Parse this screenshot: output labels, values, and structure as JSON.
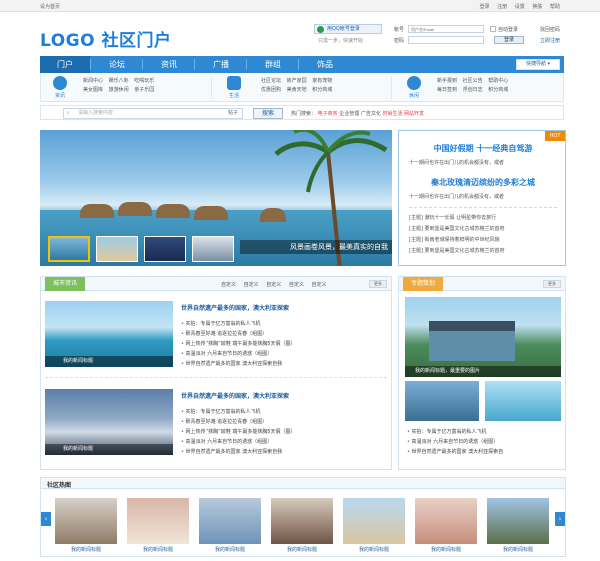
{
  "topbar": {
    "set_home": "设为首页",
    "links": [
      "登录",
      "注册",
      "设置",
      "换肤",
      "帮助"
    ]
  },
  "header": {
    "logo": "LOGO 社区门户",
    "qq_button": "用QQ帐号登录",
    "qq_sub": "只需一步，快速开始",
    "login": {
      "account_label": "帐号",
      "account_placeholder": "用户名/Email",
      "auto_login": "自动登录",
      "forgot": "找回密码",
      "password_label": "密码",
      "submit": "登录",
      "register": "立即注册"
    }
  },
  "nav": {
    "items": [
      "门户",
      "论坛",
      "资讯",
      "广播",
      "群组",
      "饰品"
    ],
    "active": 0,
    "quick": "快捷导航"
  },
  "subnav": {
    "groups": [
      {
        "label": "资讯",
        "links": [
          "新闻中心",
          "娱乐八卦",
          "吃喝玩乐",
          "美女图库",
          "旅游休闲",
          "亲子乐园"
        ],
        "color": "#2f88d4"
      },
      {
        "label": "生活",
        "links": [
          "社区论坛",
          "房产家园",
          "家有宠物",
          "优惠团购",
          "美食天地",
          "积分商城"
        ],
        "color": "#2f88d4"
      },
      {
        "label": "休闲",
        "links": [
          "新手报到",
          "社区公告",
          "帮助中心",
          "每日签到",
          "浮创日志",
          "积分商城"
        ],
        "color": "#2f88d4"
      }
    ]
  },
  "search": {
    "placeholder": "请输入搜索内容",
    "scope": "帖子",
    "button": "搜索",
    "hot_label": "热门搜索：",
    "hot_words": [
      "电子商务",
      "企业管理",
      "广告文化",
      "时尚生活",
      "网站开发"
    ]
  },
  "banner": {
    "caption": "风景画卷风景，最美真实的自我"
  },
  "right_news": {
    "hot_badge": "HOT",
    "headline1": "中国好假期  十一经典自驾游",
    "desc1": "十一期间也许在出门儿的机会都没有，或者",
    "headline2": "秦北玫瑰清迈缤纷的多彩之城",
    "desc2": "十一期间也许在出门儿的机会都没有，或者",
    "list": [
      "[主题] 潮玩十一长假 让明星带你去旅行",
      "[主题] 要到堡是美国文化古城苏格兰的首府",
      "[主题] 街南老城保持着鲜明的中世纪风貌",
      "[主题] 要到堡是美国文化古城苏格兰的首府"
    ]
  },
  "city_news": {
    "tag": "城市资讯",
    "more": "更多",
    "tabs": [
      "自定义",
      "自定义",
      "自定义",
      "自定义",
      "自定义"
    ],
    "items": [
      {
        "caption": "我的新闻标题",
        "title": "世界自然遗产最多的国家，澳大利亚探索",
        "list": [
          "实拍：专属于亿万富翁的私人飞机",
          "致青春至好滩 追逐拉拉青春（组图）",
          "网上热传“抹胸”妓鞋 端午最多能抹胸5天假（图）",
          "高温派对 六月来自节日的诱惑（组图）",
          "世界自然遗产最多的国家 澳大利亚探索自我"
        ]
      },
      {
        "caption": "我的新闻标题",
        "title": "世界自然遗产最多的国家，澳大利亚探索",
        "list": [
          "实拍：专属于亿万富翁的私人飞机",
          "致青春至好滩 追逐拉拉青春（组图）",
          "网上热传“抹胸”妓鞋 端午最多能抹胸5天假（图）",
          "高温派对 六月来自节日的诱惑（组图）",
          "世界自然遗产最多的国家 澳大利亚探索自我"
        ]
      }
    ]
  },
  "special": {
    "tag": "专题策划",
    "more": "更多",
    "caption": "我的新闻标题，最重要的图片",
    "list": [
      "实拍：专属于亿万富翁的私人飞机",
      "高温派对 六月来自节日的诱惑（组图）",
      "世界自然遗产最多的国家 澳大利亚探索自"
    ]
  },
  "hot_pics": {
    "title": "社区热图",
    "items": [
      "我的新闻标题",
      "我的新闻标题",
      "我的新闻标题",
      "我的新闻标题",
      "我的新闻标题",
      "我的新闻标题",
      "我的新闻标题"
    ]
  }
}
